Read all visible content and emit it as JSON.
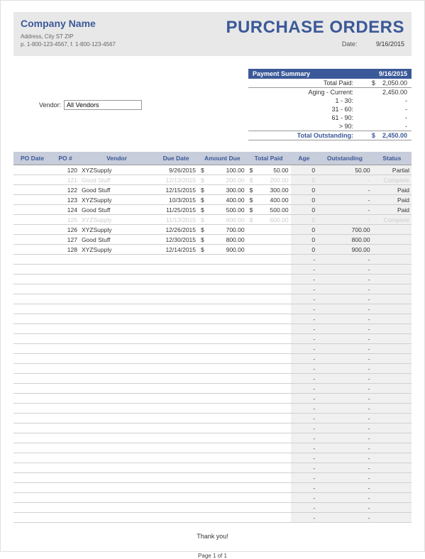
{
  "company": {
    "name": "Company Name",
    "address": "Address, City ST ZIP",
    "phones": "p. 1-800-123-4567, f. 1-800-123-4567"
  },
  "title": "PURCHASE ORDERS",
  "date": {
    "label": "Date:",
    "value": "9/16/2015"
  },
  "vendor": {
    "label": "Vendor:",
    "value": "All Vendors"
  },
  "summary": {
    "header": "Payment Summary",
    "header_date": "9/16/2015",
    "total_paid_label": "Total Paid:",
    "total_paid": "2,050.00",
    "aging_current_label": "Aging - Current:",
    "aging_current": "2,450.00",
    "age_1_30_label": "1 - 30:",
    "age_1_30": "-",
    "age_31_60_label": "31 - 60:",
    "age_31_60": "-",
    "age_61_90_label": "61 - 90:",
    "age_61_90": "-",
    "age_gt90_label": "> 90:",
    "age_gt90": "-",
    "total_outstanding_label": "Total Outstanding:",
    "total_outstanding": "2,450.00",
    "cur": "$"
  },
  "cols": {
    "podate": "PO Date",
    "po": "PO #",
    "vendor": "Vendor",
    "due": "Due Date",
    "amt": "Amount Due",
    "paid": "Total Paid",
    "age": "Age",
    "out": "Outstanding",
    "status": "Status"
  },
  "rows": [
    {
      "po": "120",
      "vendor": "XYZSupply",
      "due": "9/26/2015",
      "amt": "100.00",
      "paid": "50.00",
      "age": "0",
      "out": "50.00",
      "status": "Partial",
      "ghost": false
    },
    {
      "po": "121",
      "vendor": "Good Stuff",
      "due": "12/13/2015",
      "amt": "200.00",
      "paid": "200.00",
      "age": "0",
      "out": "-",
      "status": "Complete",
      "ghost": true
    },
    {
      "po": "122",
      "vendor": "Good Stuff",
      "due": "12/15/2015",
      "amt": "300.00",
      "paid": "300.00",
      "age": "0",
      "out": "-",
      "status": "Paid",
      "ghost": false
    },
    {
      "po": "123",
      "vendor": "XYZSupply",
      "due": "10/3/2015",
      "amt": "400.00",
      "paid": "400.00",
      "age": "0",
      "out": "-",
      "status": "Paid",
      "ghost": false
    },
    {
      "po": "124",
      "vendor": "Good Stuff",
      "due": "11/25/2015",
      "amt": "500.00",
      "paid": "500.00",
      "age": "0",
      "out": "-",
      "status": "Paid",
      "ghost": false
    },
    {
      "po": "125",
      "vendor": "XYZSupply",
      "due": "11/13/2015",
      "amt": "600.00",
      "paid": "600.00",
      "age": "0",
      "out": "-",
      "status": "Complete",
      "ghost": true
    },
    {
      "po": "126",
      "vendor": "XYZSupply",
      "due": "12/26/2015",
      "amt": "700.00",
      "paid": "",
      "age": "0",
      "out": "700.00",
      "status": "",
      "ghost": false
    },
    {
      "po": "127",
      "vendor": "Good Stuff",
      "due": "12/30/2015",
      "amt": "800.00",
      "paid": "",
      "age": "0",
      "out": "800.00",
      "status": "",
      "ghost": false
    },
    {
      "po": "128",
      "vendor": "XYZSupply",
      "due": "12/14/2015",
      "amt": "900.00",
      "paid": "",
      "age": "0",
      "out": "900.00",
      "status": "",
      "ghost": false
    }
  ],
  "blank_row_count": 27,
  "footer": {
    "thank": "Thank you!",
    "page": "Page 1 of 1"
  },
  "cur": "$",
  "dash": "-"
}
